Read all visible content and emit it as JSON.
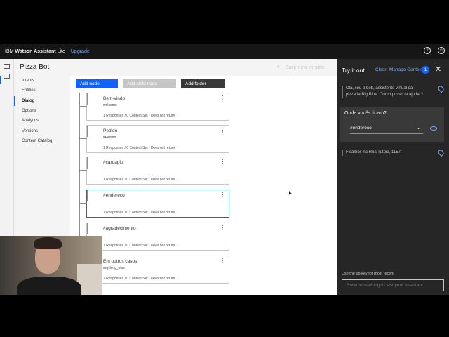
{
  "topbar": {
    "brand_prefix": "IBM",
    "brand_bold": "Watson Assistant",
    "brand_suffix": "Lite",
    "upgrade": "Upgrade",
    "help_icon": "?",
    "account_icon": "☺"
  },
  "workspace": {
    "title": "Pizza Bot",
    "search_placeholder": "Save new version"
  },
  "nav": {
    "items": [
      {
        "label": "Intents"
      },
      {
        "label": "Entities"
      },
      {
        "label": "Dialog"
      },
      {
        "label": "Options"
      },
      {
        "label": "Analytics"
      },
      {
        "label": "Versions"
      },
      {
        "label": "Content Catalog"
      }
    ],
    "active": "Dialog"
  },
  "toolbar": {
    "add_node": "Add node",
    "add_child_node": "Add child node",
    "add_folder": "Add folder"
  },
  "nodes": [
    {
      "title": "Bem-vindo",
      "condition": "welcome",
      "status": "1 Responses / 0 Context Set / Does not return"
    },
    {
      "title": "Pedido",
      "condition": "#Pedido",
      "status": "1 Responses / 0 Context Set / Does not return"
    },
    {
      "title": "#cardapio",
      "condition": "",
      "status": "1 Responses / 0 Context Set / Does not return"
    },
    {
      "title": "#endereco",
      "condition": "",
      "status": "1 Responses / 0 Context Set / Does not return"
    },
    {
      "title": "#agradecimento",
      "condition": "",
      "status": "1 Responses / 0 Context Set / Does not return"
    },
    {
      "title": "Em outros casos",
      "condition": "anything_else",
      "status": "1 Responses / 0 Context Set / Does not return"
    }
  ],
  "try_panel": {
    "title": "Try it out",
    "clear": "Clear",
    "manage_context": "Manage Context",
    "context_count": "1",
    "bot_greeting": "Olá, sou o bob, assistente virtual da pizzaria Big Blue. Como posso te ajudar?",
    "user_message": "Onde vocês ficam?",
    "detected_intent": "#endereco",
    "bot_reply": "Ficamos na Rua Tutoia, 1157.",
    "hint": "Use the up key for most recent",
    "input_placeholder": "Enter something to test your assistant"
  },
  "colors": {
    "accent": "#0f62fe",
    "link": "#78a9ff",
    "panel_bg": "#262626",
    "topbar_bg": "#161616"
  }
}
